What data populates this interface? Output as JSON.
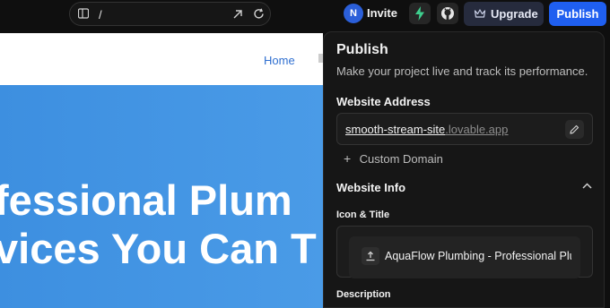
{
  "topbar": {
    "url_path": "/",
    "avatar_initial": "N",
    "invite_label": "Invite",
    "upgrade_label": "Upgrade",
    "publish_label": "Publish"
  },
  "preview": {
    "nav_home": "Home",
    "hero_line1": "fessional Plum",
    "hero_line2": "vices You Can T"
  },
  "publish_panel": {
    "title": "Publish",
    "subtitle": "Make your project live and track its performance.",
    "website_address_heading": "Website Address",
    "address_main": "smooth-stream-site",
    "address_suffix": ".lovable.app",
    "custom_domain_label": "Custom Domain",
    "website_info_heading": "Website Info",
    "icon_title_heading": "Icon & Title",
    "site_title_value": "AquaFlow Plumbing - Professional Plu",
    "description_heading": "Description"
  },
  "colors": {
    "accent": "#1f5ff0",
    "hero_blue": "#4a9be7",
    "panel_bg": "#161616"
  }
}
